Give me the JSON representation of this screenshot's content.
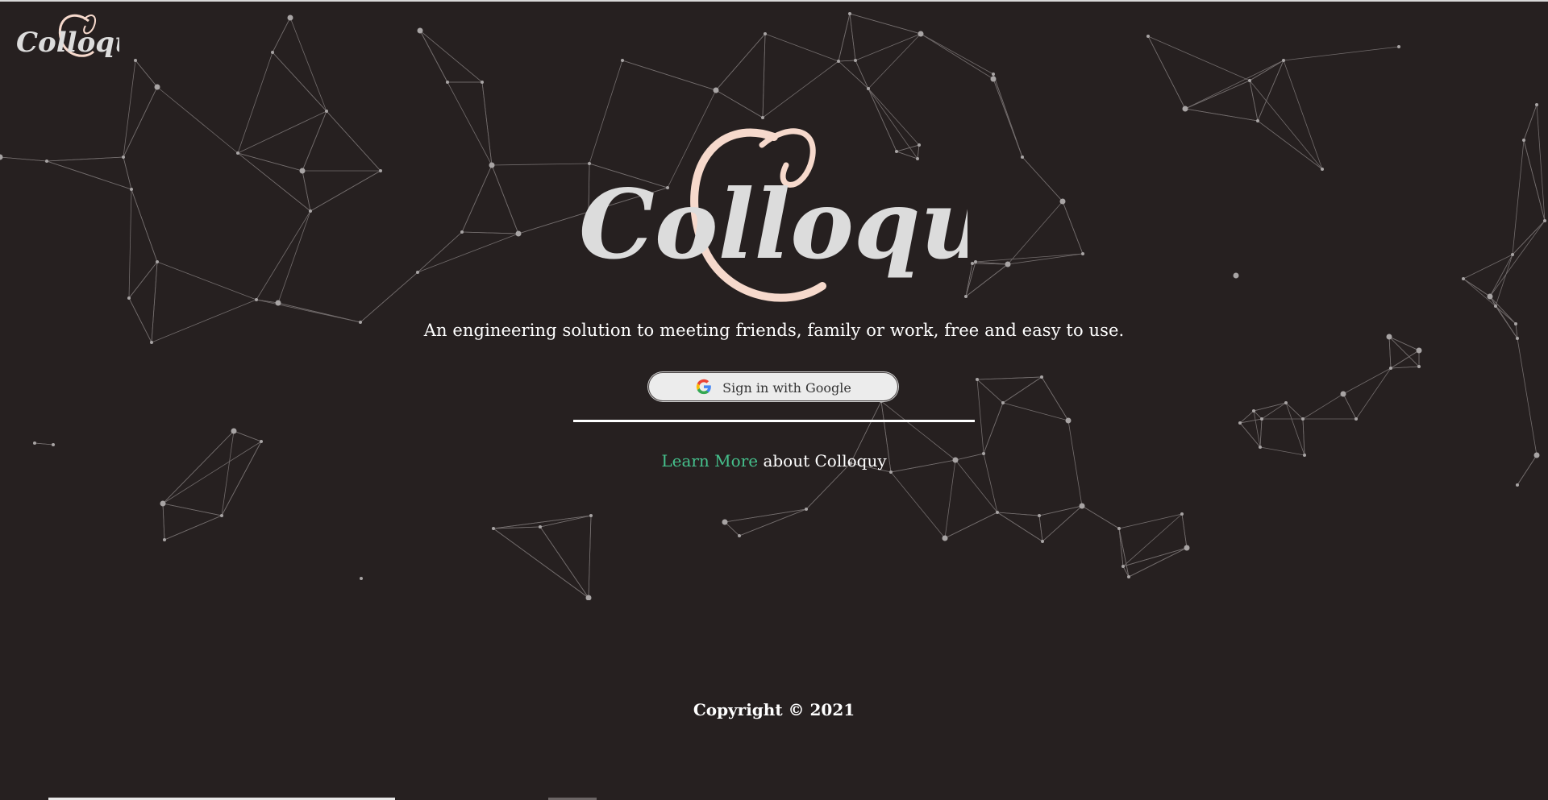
{
  "header": {
    "logo_text": "Colloquy"
  },
  "hero": {
    "logo_text": "Colloquy",
    "tagline": "An engineering solution to meeting friends, family or work, free and easy to use."
  },
  "auth": {
    "google_button_label": "Sign in with Google"
  },
  "learn_more": {
    "link_text": "Learn More",
    "suffix_text": " about Colloquy",
    "link_color": "#45c08c"
  },
  "footer": {
    "copyright": "Copyright © 2021"
  },
  "colors": {
    "background": "#262020",
    "accent_peach": "#f6d9cc",
    "logo_gray": "#dcdcdc"
  },
  "icons": [
    "google-g-icon",
    "colloquy-logo-mark"
  ]
}
